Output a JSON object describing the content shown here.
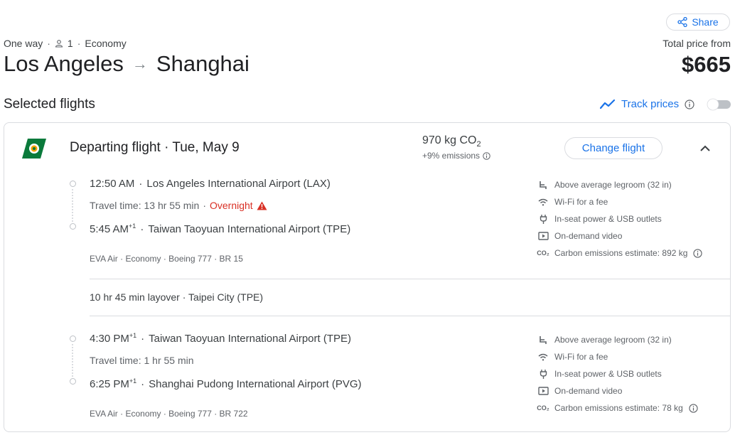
{
  "header": {
    "share_label": "Share",
    "trip_type": "One way",
    "passengers": "1",
    "cabin": "Economy",
    "origin": "Los Angeles",
    "destination": "Shanghai",
    "price_label": "Total price from",
    "price": "$665"
  },
  "selected_label": "Selected flights",
  "track_prices_label": "Track prices",
  "track_prices_enabled": false,
  "departing": {
    "title": "Departing flight",
    "date": "Tue, May 9",
    "co2_value": "970 kg CO",
    "co2_sub": "2",
    "emissions": "+9% emissions",
    "change_label": "Change flight"
  },
  "segments": [
    {
      "dep_time": "12:50 AM",
      "dep_sup": "",
      "dep_airport": "Los Angeles International Airport (LAX)",
      "travel_time": "Travel time: 13 hr 55 min",
      "overnight": "Overnight",
      "arr_time": "5:45 AM",
      "arr_sup": "+1",
      "arr_airport": "Taiwan Taoyuan International Airport (TPE)",
      "info": "EVA Air · Economy · Boeing 777 · BR 15",
      "amenities": [
        "Above average legroom (32 in)",
        "Wi-Fi for a fee",
        "In-seat power & USB outlets",
        "On-demand video",
        "Carbon emissions estimate: 892 kg"
      ]
    },
    {
      "dep_time": "4:30 PM",
      "dep_sup": "+1",
      "dep_airport": "Taiwan Taoyuan International Airport (TPE)",
      "travel_time": "Travel time: 1 hr 55 min",
      "overnight": "",
      "arr_time": "6:25 PM",
      "arr_sup": "+1",
      "arr_airport": "Shanghai Pudong International Airport (PVG)",
      "info": "EVA Air · Economy · Boeing 777 · BR 722",
      "amenities": [
        "Above average legroom (32 in)",
        "Wi-Fi for a fee",
        "In-seat power & USB outlets",
        "On-demand video",
        "Carbon emissions estimate: 78 kg"
      ]
    }
  ],
  "layover": "10 hr 45 min layover · Taipei City (TPE)",
  "colors": {
    "accent": "#1a73e8",
    "warning": "#d93025",
    "logo_green": "#0a7a3b"
  }
}
